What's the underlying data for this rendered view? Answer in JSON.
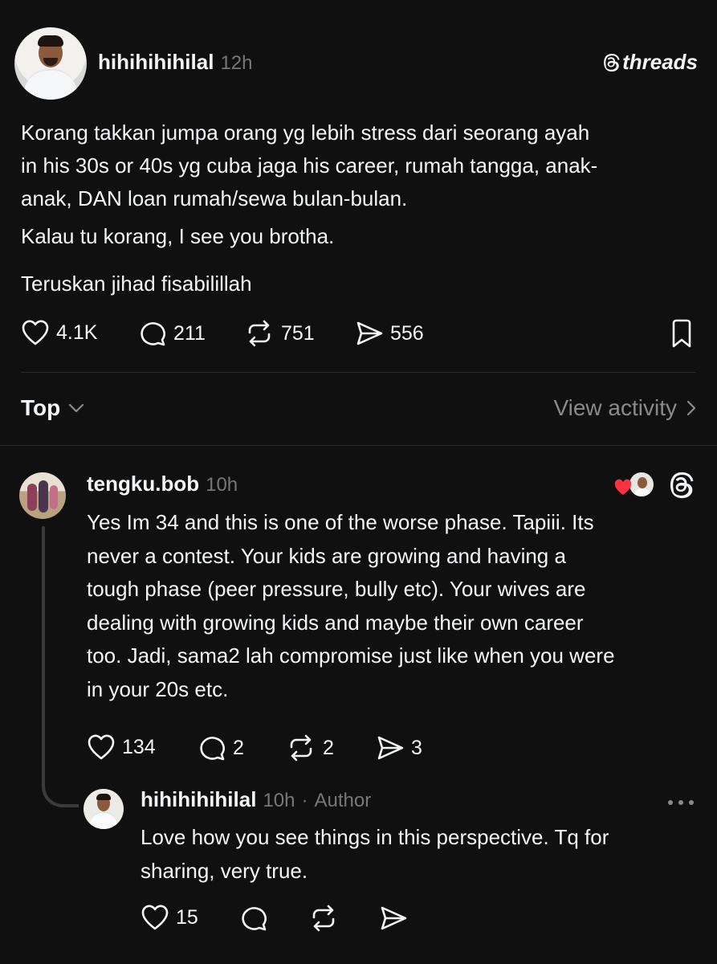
{
  "post": {
    "username": "hihihihihilal",
    "time": "12h",
    "brand": "threads",
    "lines": [
      "Korang takkan jumpa orang yg lebih stress dari seorang ayah",
      "in his 30s or 40s yg cuba jaga his career, rumah tangga, anak-",
      "anak, DAN loan rumah/sewa bulan-bulan.",
      "Kalau tu korang, I see you brotha.",
      "Teruskan jihad fisabilillah"
    ],
    "stats": {
      "likes": "4.1K",
      "replies": "211",
      "reposts": "751",
      "shares": "556"
    }
  },
  "sort": {
    "label": "Top",
    "view_activity": "View activity"
  },
  "reply": {
    "username": "tengku.bob",
    "time": "10h",
    "lines": [
      "Yes Im 34 and this is one of the worse phase. Tapiii. Its",
      "never a contest. Your kids are growing and having a",
      "tough phase (peer pressure, bully etc). Your wives are",
      "dealing with growing kids and maybe their own career",
      "too. Jadi, sama2 lah compromise just like when you were",
      "in your 20s etc."
    ],
    "stats": {
      "likes": "134",
      "replies": "2",
      "reposts": "2",
      "shares": "3"
    }
  },
  "nested_reply": {
    "username": "hihihihihilal",
    "time": "10h",
    "separator": "·",
    "author_tag": "Author",
    "lines": [
      "Love how you see things in this perspective. Tq for",
      "sharing, very true."
    ],
    "stats": {
      "likes": "15"
    }
  },
  "icons": {
    "like": "heart-icon",
    "reply": "comment-icon",
    "repost": "repost-icon",
    "share": "send-icon",
    "save": "bookmark-icon",
    "more": "more-icon",
    "chevron_down": "chevron-down-icon",
    "chevron_right": "chevron-right-icon",
    "threads": "threads-logo-icon"
  },
  "colors": {
    "background": "#101010",
    "text": "#f3f5f7",
    "muted": "#777777",
    "liked_heart": "#ff3040"
  }
}
